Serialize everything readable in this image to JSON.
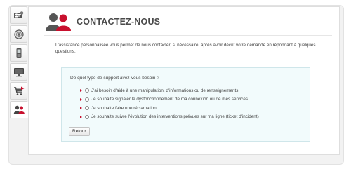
{
  "sidebar": {
    "items": [
      {
        "icon": "contact-card-icon",
        "active": false
      },
      {
        "icon": "compass-icon",
        "active": false
      },
      {
        "icon": "mobile-phone-icon",
        "active": false
      },
      {
        "icon": "monitor-icon",
        "active": false
      },
      {
        "icon": "shopping-cart-icon",
        "active": false
      },
      {
        "icon": "people-icon",
        "active": true
      }
    ]
  },
  "header": {
    "title": "CONTACTEZ-NOUS",
    "icon": "people-icon"
  },
  "intro": "L'assistance personnalisée vous permet de nous contacter, si nécessaire, après avoir décrit votre demande en répondant à quelques questions.",
  "form": {
    "question": "De quel type de support avez-vous besoin ?",
    "options": [
      "J'ai besoin d'aide à une manipulation, d'informations ou de renseignements",
      "Je souhaite signaler le dysfonctionnement de ma connexion ou de mes services",
      "Je souhaite faire une réclamation",
      "Je souhaite suivre l'évolution des interventions prévues sur ma ligne (ticket d'incident)"
    ],
    "back_label": "Retour"
  },
  "colors": {
    "accent": "#c8102e",
    "title": "#4a4a4a",
    "box_bg": "#f2fbfc",
    "box_border": "#cfe6ea"
  }
}
